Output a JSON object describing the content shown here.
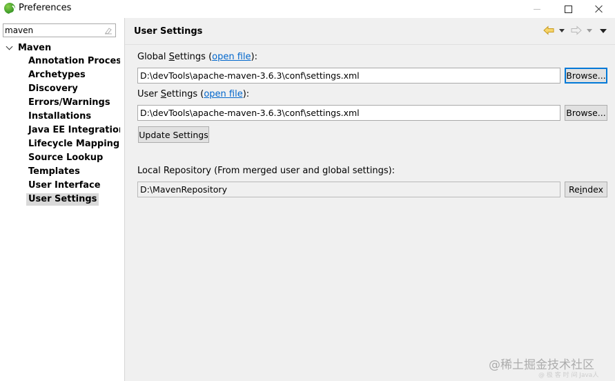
{
  "window": {
    "title": "Preferences"
  },
  "filter": {
    "value": "maven"
  },
  "tree": {
    "root": "Maven",
    "items": [
      "Annotation Processing",
      "Archetypes",
      "Discovery",
      "Errors/Warnings",
      "Installations",
      "Java EE Integration",
      "Lifecycle Mappings",
      "Source Lookup",
      "Templates",
      "User Interface",
      "User Settings"
    ],
    "selected": "User Settings"
  },
  "page": {
    "title": "User Settings",
    "global": {
      "label_pre": "Global ",
      "label_mnemonic": "S",
      "label_post": "ettings (",
      "link": "open file",
      "label_end": "):",
      "path": "D:\\devTools\\apache-maven-3.6.3\\conf\\settings.xml",
      "browse": "Browse..."
    },
    "user": {
      "label_pre": "User ",
      "label_mnemonic": "S",
      "label_post": "ettings (",
      "link": "open file",
      "label_end": "):",
      "path": "D:\\devTools\\apache-maven-3.6.3\\conf\\settings.xml",
      "browse": "Browse..."
    },
    "update_button": "Update Settings",
    "local_repo": {
      "label": "Local Repository (From merged user and global settings):",
      "path": "D:\\MavenRepository",
      "reindex_pre": "Re",
      "reindex_mnemonic": "i",
      "reindex_post": "ndex"
    }
  },
  "watermark": {
    "main": "@稀土掘金技术社区",
    "sub": "@ 极 客 时 间 Java人"
  },
  "colors": {
    "link": "#0066cc",
    "selection": "#d9d9d9",
    "panel_bg": "#f0f0f0",
    "focus": "#0078d7"
  }
}
